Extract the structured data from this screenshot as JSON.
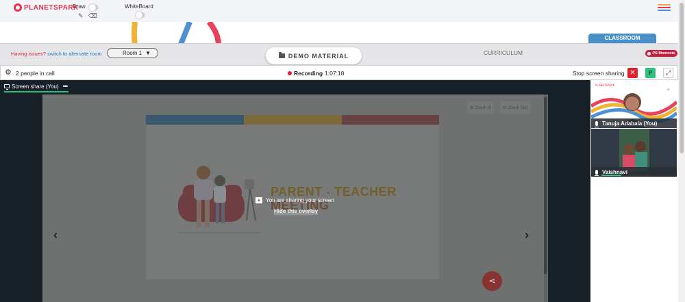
{
  "brand": {
    "name": "PLANETSPARK"
  },
  "tools": {
    "draw_label": "Draw",
    "whiteboard_label": "WhiteBoard",
    "pencil_icon": "pencil-icon",
    "eraser_icon": "eraser-icon"
  },
  "classroom": {
    "tab_label": "CLASSROOM"
  },
  "controls": {
    "issues_text": "Having issues?",
    "alternate_link": "switch to alternate room",
    "room_select": "Room 1",
    "demo_material": "DEMO MATERIAL",
    "curriculum": "CURRICULUM",
    "moments": "PS Moments"
  },
  "call": {
    "people": "2 people in call",
    "recording_label": "Recording",
    "recording_time": "1:07:18",
    "stop_sharing": "Stop screen sharing",
    "stop_icon": "✕",
    "p_badge": "P",
    "expand_icon": "⤢"
  },
  "stage": {
    "share_tab": "Screen share (You)",
    "zoom_in": "Zoom In",
    "zoom_out": "Zoom Out",
    "slide_title_1": "PARENT - TEACHER",
    "slide_title_2": "MEETING",
    "sharing_msg": "You are sharing your screen",
    "hide_overlay": "Hide this overlay"
  },
  "participants": [
    {
      "name": "Tanuja Adabala (You)"
    },
    {
      "name": "Vaishnavi"
    }
  ],
  "colors": {
    "accent_red": "#e0222f",
    "classroom_blue": "#4a90c8",
    "green": "#2ec27e",
    "stage_bg": "#182027"
  }
}
